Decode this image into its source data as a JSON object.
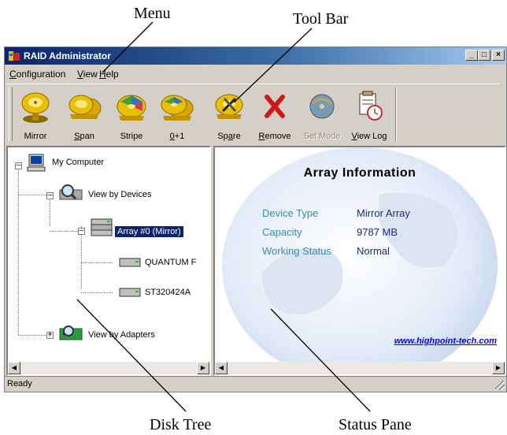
{
  "callouts": {
    "menu": "Menu",
    "toolbar": "Tool Bar",
    "disk_tree": "Disk Tree",
    "status_pane": "Status Pane"
  },
  "window": {
    "title": "RAID Administrator",
    "buttons": [
      "_",
      "□",
      "×"
    ]
  },
  "menu": {
    "items": [
      {
        "label": "Configuration",
        "accel": "C"
      },
      {
        "label": "View",
        "accel": "V"
      },
      {
        "label": "Help",
        "accel": "H"
      }
    ]
  },
  "toolbar": {
    "buttons": [
      {
        "label": "Mirror",
        "icon": "mirror-disk-icon",
        "enabled": true
      },
      {
        "label": "Span",
        "icon": "span-disk-icon",
        "enabled": true
      },
      {
        "label": "Stripe",
        "icon": "stripe-disk-icon",
        "enabled": true
      },
      {
        "label": "0+1",
        "icon": "raid01-disk-icon",
        "enabled": true
      },
      {
        "label": "Spare",
        "icon": "spare-disk-icon",
        "enabled": true
      },
      {
        "label": "Remove",
        "icon": "remove-x-icon",
        "enabled": true
      },
      {
        "label": "Set Mode",
        "icon": "set-mode-disc-icon",
        "enabled": false
      },
      {
        "label": "View Log",
        "icon": "log-clock-icon",
        "enabled": true
      }
    ]
  },
  "tree": {
    "my_computer": "My Computer",
    "view_by_devices": "View by Devices",
    "array": "Array #0 (Mirror)",
    "disk1": "QUANTUM F",
    "disk2": "ST320424A",
    "view_by_adapters": "View by Adapters"
  },
  "array_info": {
    "title": "Array Information",
    "rows": [
      {
        "key": "Device Type",
        "value": "Mirror Array"
      },
      {
        "key": "Capacity",
        "value": "9787 MB"
      },
      {
        "key": "Working Status",
        "value": "Normal"
      }
    ],
    "link": "www.highpoint-tech.com"
  },
  "statusbar": {
    "text": "Ready"
  },
  "colors": {
    "title_gradient_start": "#0a246a",
    "selection": "#0a246a",
    "info_key": "#3a8aa8",
    "info_value": "#1a2f6a",
    "link": "#0000ff"
  }
}
